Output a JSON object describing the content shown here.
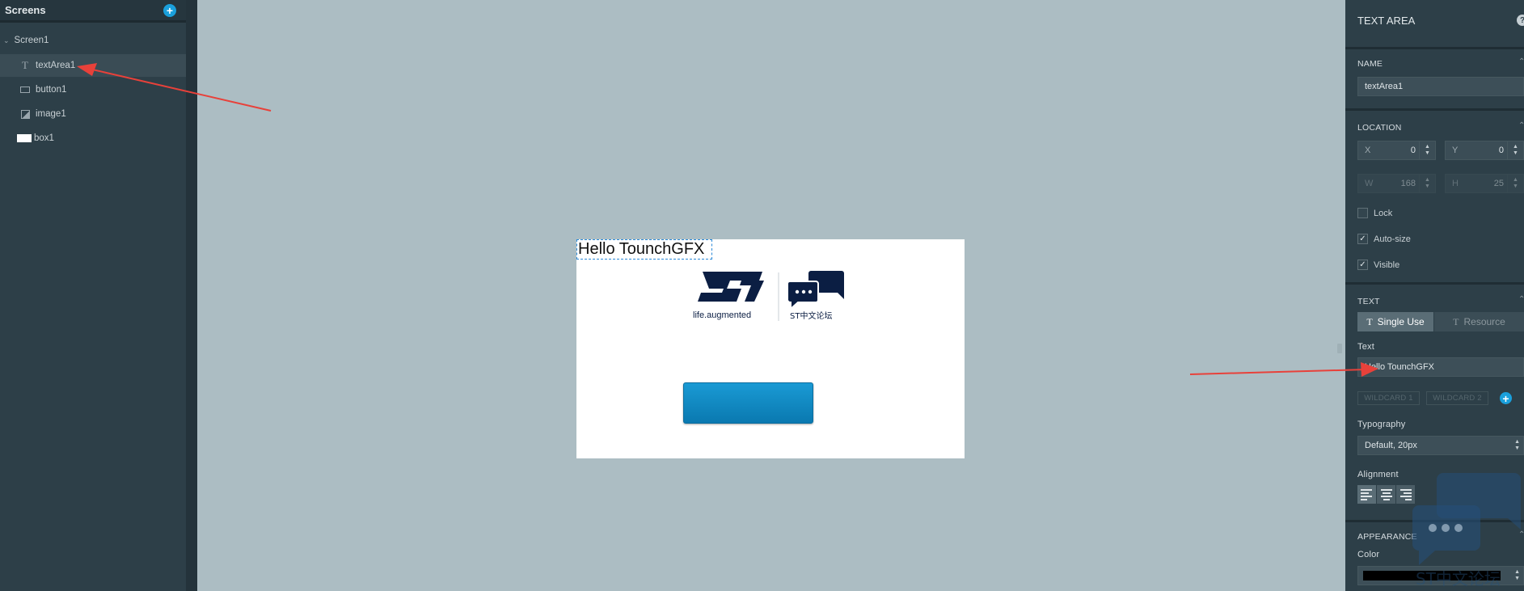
{
  "left_panel": {
    "title": "Screens",
    "add_icon": "plus-icon",
    "screen": {
      "label": "Screen1",
      "icon": "chevron-down-icon"
    },
    "widgets": [
      {
        "label": "textArea1",
        "icon": "text-icon",
        "selected": true
      },
      {
        "label": "button1",
        "icon": "button-icon",
        "selected": false
      },
      {
        "label": "image1",
        "icon": "image-icon",
        "selected": false
      },
      {
        "label": "box1",
        "icon": "box-icon",
        "selected": false
      }
    ]
  },
  "canvas": {
    "text_area_text": "Hello TounchGFX",
    "logo_tagline": "life.augmented",
    "logo_forum": "ST中文论坛",
    "button_label": ""
  },
  "properties": {
    "title": "TEXT AREA",
    "help_icon": "question-icon",
    "name": {
      "section": "NAME",
      "value": "textArea1"
    },
    "location": {
      "section": "LOCATION",
      "x": {
        "label": "X",
        "value": "0"
      },
      "y": {
        "label": "Y",
        "value": "0"
      },
      "w": {
        "label": "W",
        "value": "168"
      },
      "h": {
        "label": "H",
        "value": "25"
      },
      "lock": {
        "label": "Lock",
        "checked": false
      },
      "auto_size": {
        "label": "Auto-size",
        "checked": true
      },
      "visible": {
        "label": "Visible",
        "checked": true
      }
    },
    "text": {
      "section": "TEXT",
      "tab_single": "Single Use",
      "tab_resource": "Resource",
      "text_label": "Text",
      "text_value": "Hello TounchGFX",
      "wildcard1": "WILDCARD 1",
      "wildcard2": "WILDCARD 2",
      "typography_label": "Typography",
      "typography_value": "Default,  20px",
      "alignment_label": "Alignment"
    },
    "appearance": {
      "section": "APPEARANCE",
      "color_label": "Color",
      "color_value": "#000000"
    }
  },
  "watermark": {
    "text": "ST中文论坛"
  },
  "colors": {
    "accent": "#1aa0dc",
    "arrow": "#e8413a",
    "panel": "#2d3f48",
    "canvas_bg": "#acbdc3"
  }
}
